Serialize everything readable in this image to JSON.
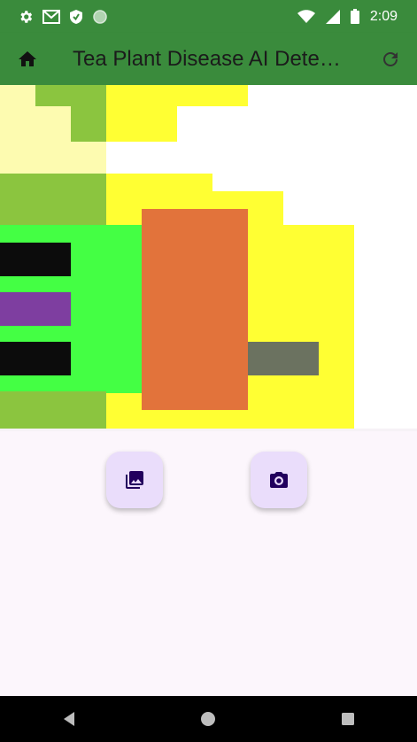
{
  "status_bar": {
    "time": "2:09",
    "icons": [
      "settings-icon",
      "gmail-icon",
      "shield-icon",
      "circle-icon",
      "wifi-icon",
      "cellular-icon",
      "battery-icon"
    ]
  },
  "app_bar": {
    "title": "Tea Plant Disease AI  Dete…",
    "home_icon": "home-icon",
    "refresh_icon": "refresh-icon",
    "color": "#3a8b3c"
  },
  "actions": {
    "gallery_icon": "photo-library-icon",
    "camera_icon": "camera-icon",
    "fab_color": "#eaddfb",
    "icon_color": "#22005d"
  },
  "nav": {
    "back": "back-icon",
    "home": "home-circle-icon",
    "recents": "recents-icon"
  }
}
